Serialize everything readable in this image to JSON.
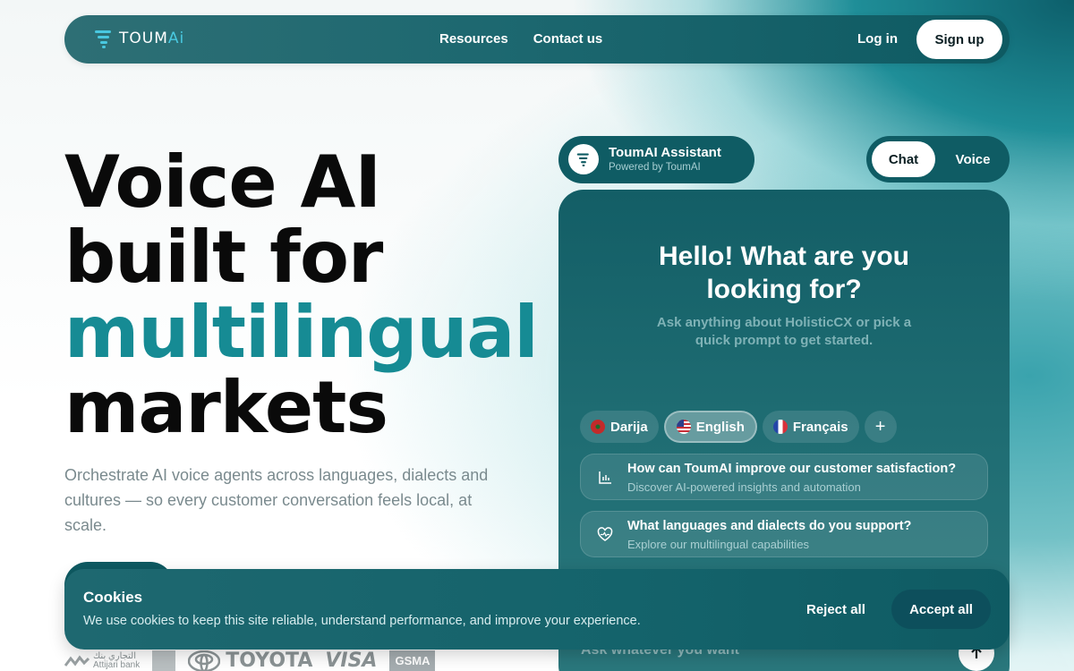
{
  "nav": {
    "brand_main": "TOUM",
    "brand_ai": "Ai",
    "links": [
      "Resources",
      "Contact us"
    ],
    "login": "Log in",
    "signup": "Sign up"
  },
  "hero": {
    "title_line1": "Voice AI",
    "title_line2": "built for",
    "title_accent": "multilingual",
    "title_line4": "markets",
    "subtitle": "Orchestrate AI voice agents across languages, dialects and cultures — so every customer conversation feels local, at scale.",
    "accent_color": "#168b94"
  },
  "logos": {
    "attijari_ar": "التجاري بنك",
    "attijari_en": "Attijari bank",
    "toyota": "TOYOTA",
    "visa": "VISA",
    "gsma": "GSMA"
  },
  "assistant": {
    "name": "ToumAI Assistant",
    "powered_by": "Powered by ToumAI",
    "mode_chat": "Chat",
    "mode_voice": "Voice",
    "heading": "Hello! What are you looking for?",
    "subheading": "Ask anything about HolisticCX or pick a quick prompt to get started.",
    "languages": [
      {
        "label": "Darija",
        "flag": "morocco-flag-icon"
      },
      {
        "label": "English",
        "flag": "us-flag-icon",
        "active": true
      },
      {
        "label": "Français",
        "flag": "france-flag-icon"
      }
    ],
    "add_language": "+",
    "prompts": [
      {
        "title": "How can ToumAI improve our customer satisfaction?",
        "desc": "Discover AI-powered insights and automation",
        "icon": "bar-chart-icon"
      },
      {
        "title": "What languages and dialects do you support?",
        "desc": "Explore our multilingual capabilities",
        "icon": "heart-pulse-icon"
      }
    ],
    "input_placeholder": "Ask whatever you want"
  },
  "cookies": {
    "title": "Cookies",
    "text": "We use cookies to keep this site reliable, understand performance, and improve your experience.",
    "reject": "Reject all",
    "accept": "Accept all"
  }
}
